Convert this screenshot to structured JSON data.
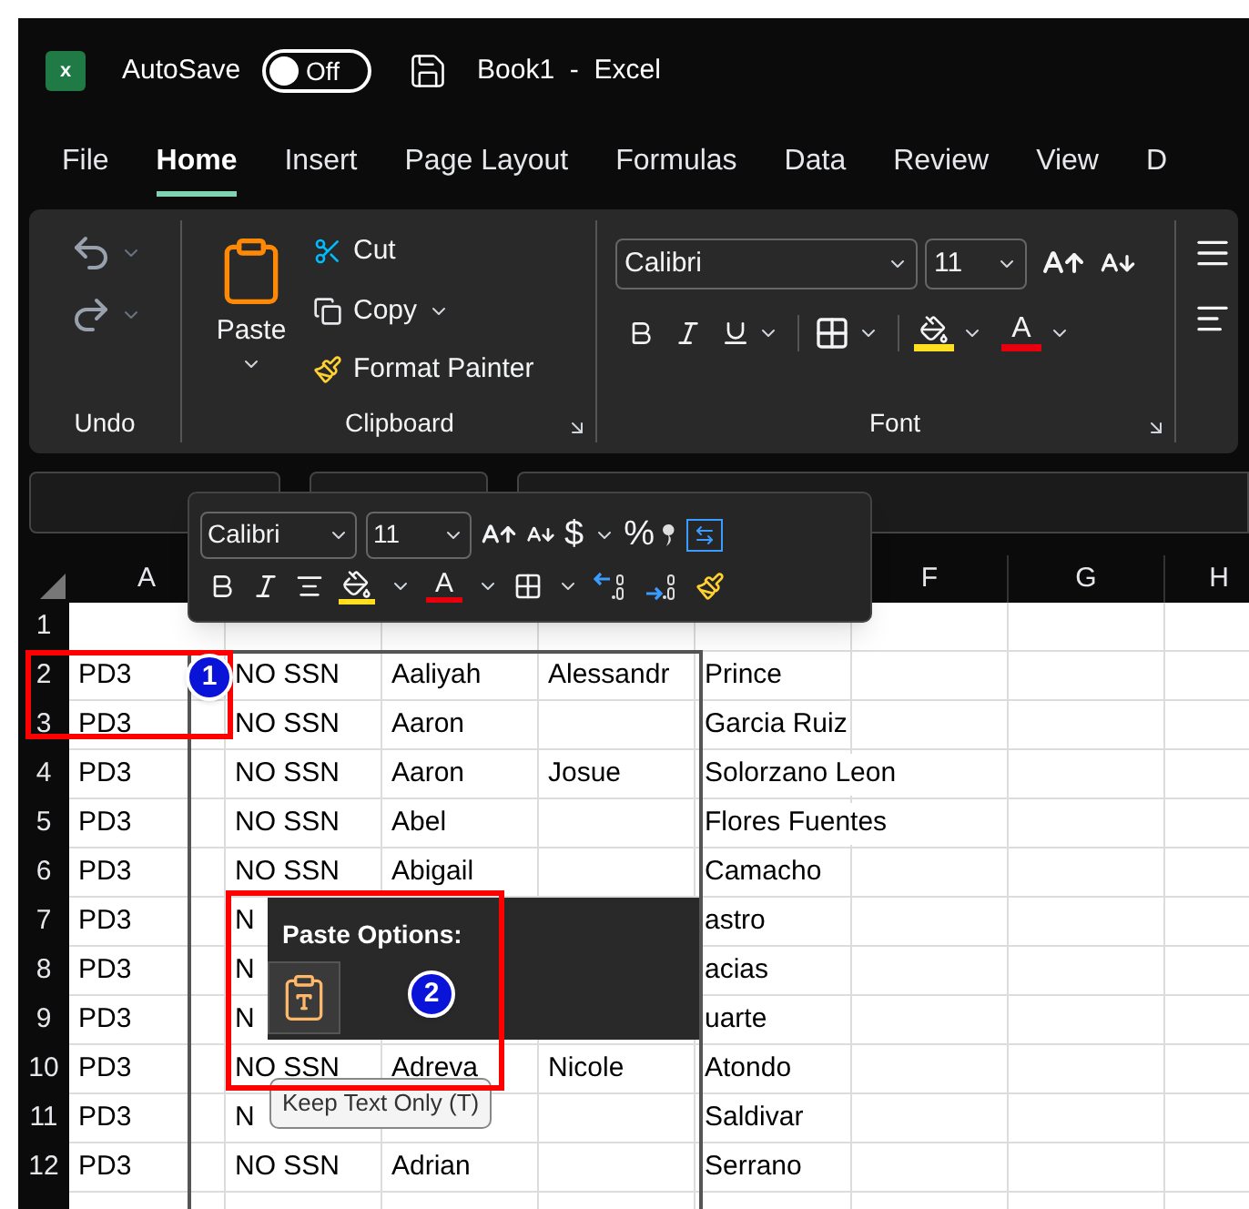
{
  "title_bar": {
    "app_icon": "x",
    "autosave": {
      "label": "AutoSave",
      "on": false,
      "state_label": "Off"
    },
    "title": "Book1  -  Excel"
  },
  "tabs": [
    {
      "label": "File",
      "selected": false
    },
    {
      "label": "Home",
      "selected": true
    },
    {
      "label": "Insert",
      "selected": false
    },
    {
      "label": "Page Layout",
      "selected": false
    },
    {
      "label": "Formulas",
      "selected": false
    },
    {
      "label": "Data",
      "selected": false
    },
    {
      "label": "Review",
      "selected": false
    },
    {
      "label": "View",
      "selected": false
    },
    {
      "label": "D",
      "selected": false
    }
  ],
  "ribbon": {
    "undo": {
      "label": "Undo"
    },
    "clipboard": {
      "label": "Clipboard",
      "paste": "Paste",
      "items": [
        {
          "kind": "cut",
          "label": "Cut"
        },
        {
          "kind": "copy",
          "label": "Copy"
        },
        {
          "kind": "painter",
          "label": "Format Painter"
        }
      ]
    },
    "font": {
      "label": "Font",
      "font_name": "Calibri",
      "font_size": "11",
      "font_color_glyph": "A"
    }
  },
  "mini_toolbar": {
    "font_name": "Calibri",
    "font_size": "11",
    "currency": "$",
    "percent": "%",
    "font_color_glyph": "A"
  },
  "grid": {
    "columns": [
      {
        "header": "A"
      },
      {},
      {},
      {},
      {},
      {
        "header": "F"
      },
      {
        "header": "G"
      },
      {
        "header": "H"
      }
    ],
    "rows": [
      {
        "number": "1",
        "cells": [
          null,
          null,
          null,
          null,
          null
        ]
      },
      {
        "number": "2",
        "cells": [
          "PD3",
          "NO SSN",
          "Aaliyah",
          "Alessandr",
          "Prince"
        ]
      },
      {
        "number": "3",
        "cells": [
          "PD3",
          "NO SSN",
          "Aaron",
          null,
          "Garcia Ruiz"
        ]
      },
      {
        "number": "4",
        "cells": [
          "PD3",
          "NO SSN",
          "Aaron",
          "Josue",
          "Solorzano Leon"
        ]
      },
      {
        "number": "5",
        "cells": [
          "PD3",
          "NO SSN",
          "Abel",
          null,
          "Flores Fuentes"
        ]
      },
      {
        "number": "6",
        "cells": [
          "PD3",
          "NO SSN",
          "Abigail",
          null,
          "Camacho"
        ]
      },
      {
        "number": "7",
        "cells": [
          "PD3",
          "N",
          null,
          null,
          "astro"
        ]
      },
      {
        "number": "8",
        "cells": [
          "PD3",
          "N",
          null,
          null,
          "acias"
        ]
      },
      {
        "number": "9",
        "cells": [
          "PD3",
          "N",
          null,
          null,
          "uarte"
        ]
      },
      {
        "number": "10",
        "cells": [
          "PD3",
          "NO SSN",
          "Adreva",
          "Nicole",
          "Atondo"
        ]
      },
      {
        "number": "11",
        "cells": [
          "PD3",
          "N",
          null,
          null,
          "Saldivar"
        ]
      },
      {
        "number": "12",
        "cells": [
          "PD3",
          "NO SSN",
          "Adrian",
          null,
          "Serrano"
        ]
      }
    ]
  },
  "paste_options": {
    "title": "Paste Options:",
    "tooltip": "Keep Text Only (T)"
  },
  "callouts": [
    {
      "label": "1"
    },
    {
      "label": "2"
    }
  ]
}
